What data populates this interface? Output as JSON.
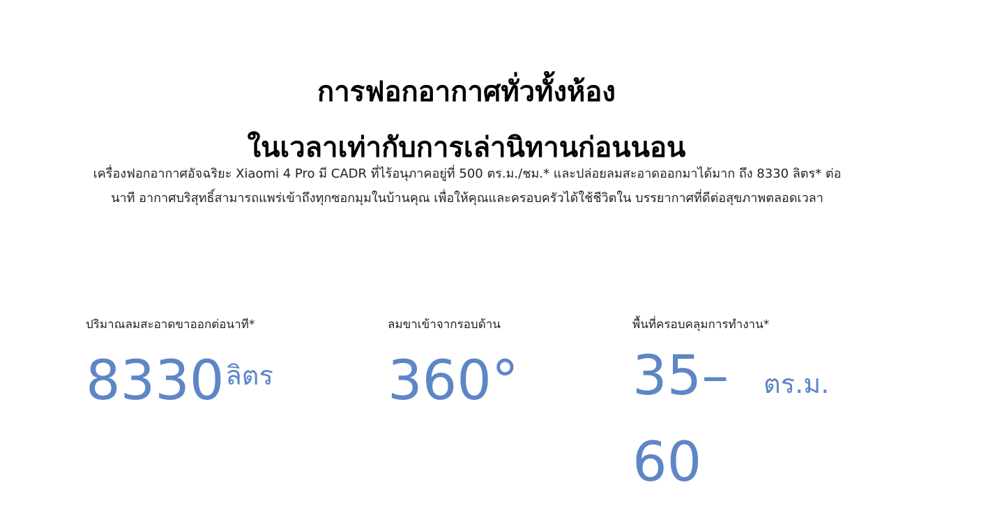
{
  "heading": {
    "line1": "การฟอกอากาศทั่วทั้งห้อง",
    "line2": "ในเวลาเท่ากับการเล่านิทานก่อนนอน"
  },
  "description": "เครื่องฟอกอากาศอัจฉริยะ Xiaomi 4 Pro มี CADR ที่ไร้อนุภาคอยู่ที่ 500 ตร.ม./ชม.* และปล่อยลมสะอาดออกมาได้มาก ถึง 8330 ลิตร* ต่อนาที อากาศบริสุทธิ์สามารถแพร่เข้าถึงทุกซอกมุมในบ้านคุณ เพื่อให้คุณและครอบครัวได้ใช้ชีวิตใน บรรยากาศที่ดีต่อสุขภาพตลอดเวลา",
  "stats": [
    {
      "label": "ปริมาณลมสะอาดขาออกต่อนาที*",
      "value": "8330",
      "unit": "ลิตร"
    },
    {
      "label": "ลมขาเข้าจากรอบด้าน",
      "value": "360°",
      "unit": ""
    },
    {
      "label": "พื้นที่ครอบคลุมการทำงาน*",
      "value": "35–60",
      "unit": "ตร.ม."
    }
  ],
  "colors": {
    "accent": "#5e86c6",
    "text": "#000000",
    "body_text": "#222222",
    "background": "#ffffff"
  }
}
